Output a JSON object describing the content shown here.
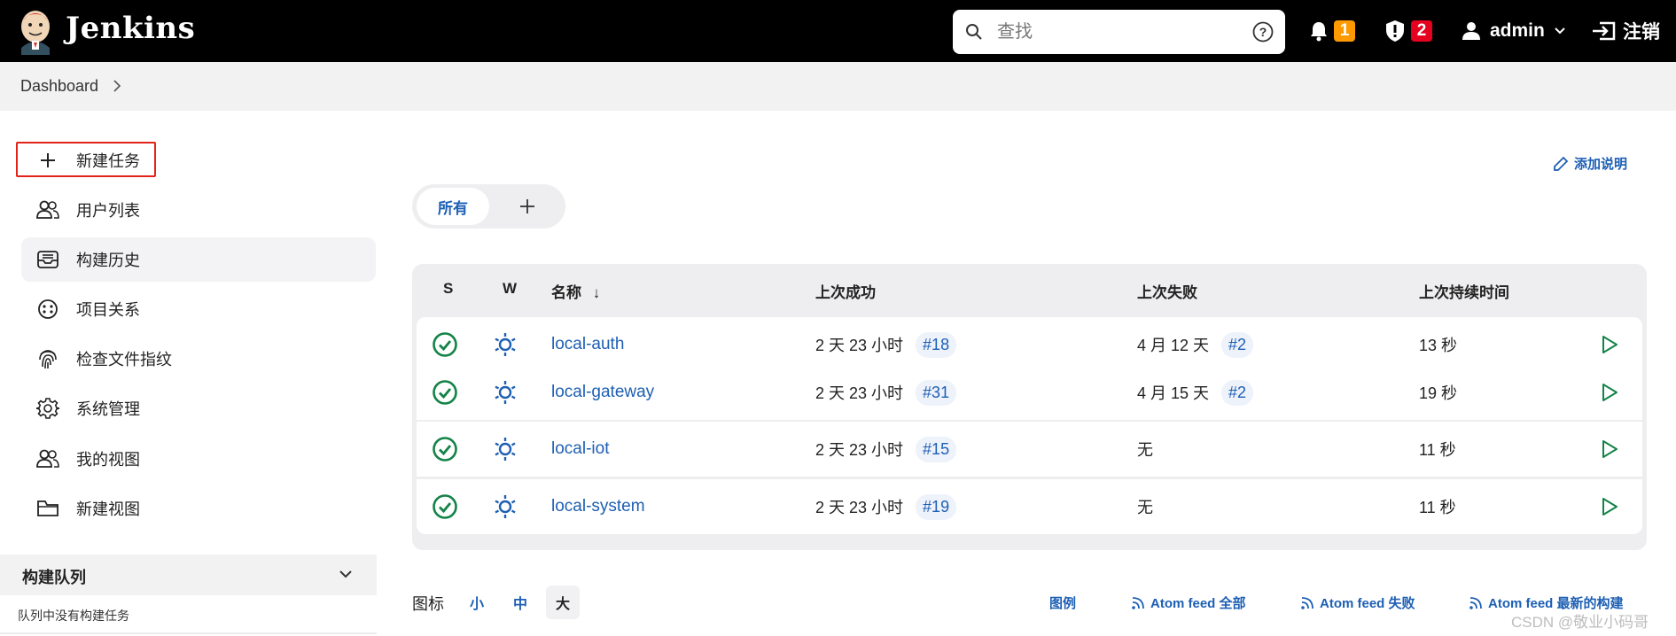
{
  "header": {
    "brand": "Jenkins",
    "search_placeholder": "查找",
    "notifications_count": "1",
    "security_count": "2",
    "user": "admin",
    "logout": "注销"
  },
  "breadcrumb": {
    "item": "Dashboard"
  },
  "sidebar": {
    "items": [
      {
        "label": "新建任务",
        "icon": "plus-icon"
      },
      {
        "label": "用户列表",
        "icon": "users-icon"
      },
      {
        "label": "构建历史",
        "icon": "inbox-icon"
      },
      {
        "label": "项目关系",
        "icon": "relationship-icon"
      },
      {
        "label": "检查文件指纹",
        "icon": "fingerprint-icon"
      },
      {
        "label": "系统管理",
        "icon": "gear-icon"
      },
      {
        "label": "我的视图",
        "icon": "users-icon"
      },
      {
        "label": "新建视图",
        "icon": "folder-icon"
      }
    ],
    "queue_title": "构建队列",
    "queue_empty": "队列中没有构建任务"
  },
  "main": {
    "add_description": "添加说明",
    "tabs": [
      {
        "label": "所有"
      }
    ],
    "table": {
      "headers": {
        "status": "S",
        "weather": "W",
        "name": "名称",
        "sort_arrow": "↓",
        "last_success": "上次成功",
        "last_failure": "上次失败",
        "last_duration": "上次持续时间"
      },
      "rows": [
        {
          "name": "local-auth",
          "last_success": "2 天 23 小时",
          "success_build": "#18",
          "last_failure": "4 月 12 天",
          "failure_build": "#2",
          "duration": "13 秒"
        },
        {
          "name": "local-gateway",
          "last_success": "2 天 23 小时",
          "success_build": "#31",
          "last_failure": "4 月 15 天",
          "failure_build": "#2",
          "duration": "19 秒"
        },
        {
          "name": "local-iot",
          "last_success": "2 天 23 小时",
          "success_build": "#15",
          "last_failure": "无",
          "failure_build": "",
          "duration": "11 秒"
        },
        {
          "name": "local-system",
          "last_success": "2 天 23 小时",
          "success_build": "#19",
          "last_failure": "无",
          "failure_build": "",
          "duration": "11 秒"
        }
      ]
    },
    "footer": {
      "icon_label": "图标",
      "sizes": [
        "小",
        "中",
        "大"
      ],
      "selected_size": "大",
      "legend": "图例",
      "feed_all": "Atom feed 全部",
      "feed_failed": "Atom feed 失败",
      "feed_latest": "Atom feed 最新的构建"
    }
  },
  "watermark": "CSDN @敬业小码哥",
  "colors": {
    "link": "#1d5fb4",
    "success": "#138347",
    "highlight_box": "#e2231a",
    "badge_orange": "#fe9a00",
    "badge_red": "#e6001f"
  }
}
